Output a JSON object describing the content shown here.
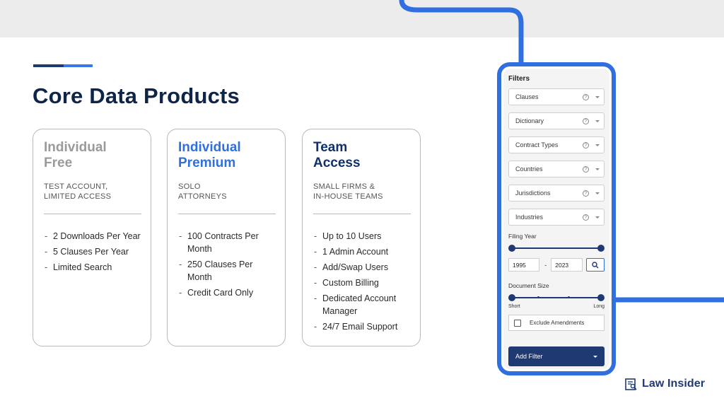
{
  "page": {
    "title": "Core Data Products"
  },
  "cards": [
    {
      "title": "Individual\nFree",
      "subtitle": "TEST ACCOUNT,\nLIMITED ACCESS",
      "items": [
        "2 Downloads Per Year",
        "5 Clauses Per Year",
        "Limited Search"
      ]
    },
    {
      "title": "Individual\nPremium",
      "subtitle": "SOLO\nATTORNEYS",
      "items": [
        "100 Contracts Per Month",
        "250 Clauses Per Month",
        "Credit Card Only"
      ]
    },
    {
      "title": "Team\nAccess",
      "subtitle": "SMALL FIRMS &\nIN-HOUSE TEAMS",
      "items": [
        "Up to 10 Users",
        "1 Admin Account",
        "Add/Swap Users",
        "Custom Billing",
        "Dedicated Account Manager",
        "24/7 Email Support"
      ]
    }
  ],
  "filters": {
    "title": "Filters",
    "dropdowns": [
      "Clauses",
      "Dictionary",
      "Contract Types",
      "Countries",
      "Jurisdictions",
      "Industries"
    ],
    "help_glyph": "?",
    "filing_year": {
      "label": "Filing Year",
      "from": "1995",
      "dash": "-",
      "to": "2023"
    },
    "document_size": {
      "label": "Document Size",
      "min_label": "Short",
      "max_label": "Long"
    },
    "exclude_label": "Exclude Amendments",
    "add_filter_label": "Add Filter"
  },
  "brand": {
    "name": "Law Insider"
  },
  "colors": {
    "accent": "#2f6fe0",
    "navy": "#1f3a73",
    "gray_title": "#9a9a9a"
  }
}
